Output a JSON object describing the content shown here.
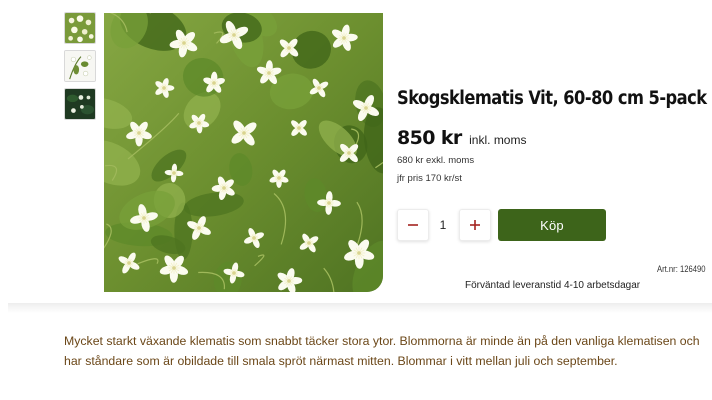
{
  "product": {
    "title": "Skogsklematis Vit, 60-80 cm 5-pack",
    "price": "850 kr",
    "price_suffix": "inkl. moms",
    "price_exkl": "680 kr exkl. moms",
    "comparison_price": "jfr pris 170 kr/st",
    "quantity": "1",
    "buy_label": "Köp",
    "article_number": "Art.nr: 126490",
    "delivery": "Förväntad leveranstid 4-10 arbetsdagar",
    "description": "Mycket starkt växande klematis som snabbt täcker stora ytor. Blommorna är minde än på den vanliga klematisen och har ståndare som är obildade till smala spröt närmast mitten. Blommar i vitt mellan juli och september."
  },
  "gallery": {
    "thumbnails": [
      "white-clematis-cluster",
      "white-clematis-on-white",
      "dark-foliage-with-flowers"
    ],
    "main": "white-clematis-flowers-photo"
  },
  "icons": {
    "minus": "minus-icon",
    "plus": "plus-icon"
  },
  "colors": {
    "buy_button": "#3d641a",
    "qty_icon": "#a3231f",
    "description_text": "#6b4718"
  }
}
